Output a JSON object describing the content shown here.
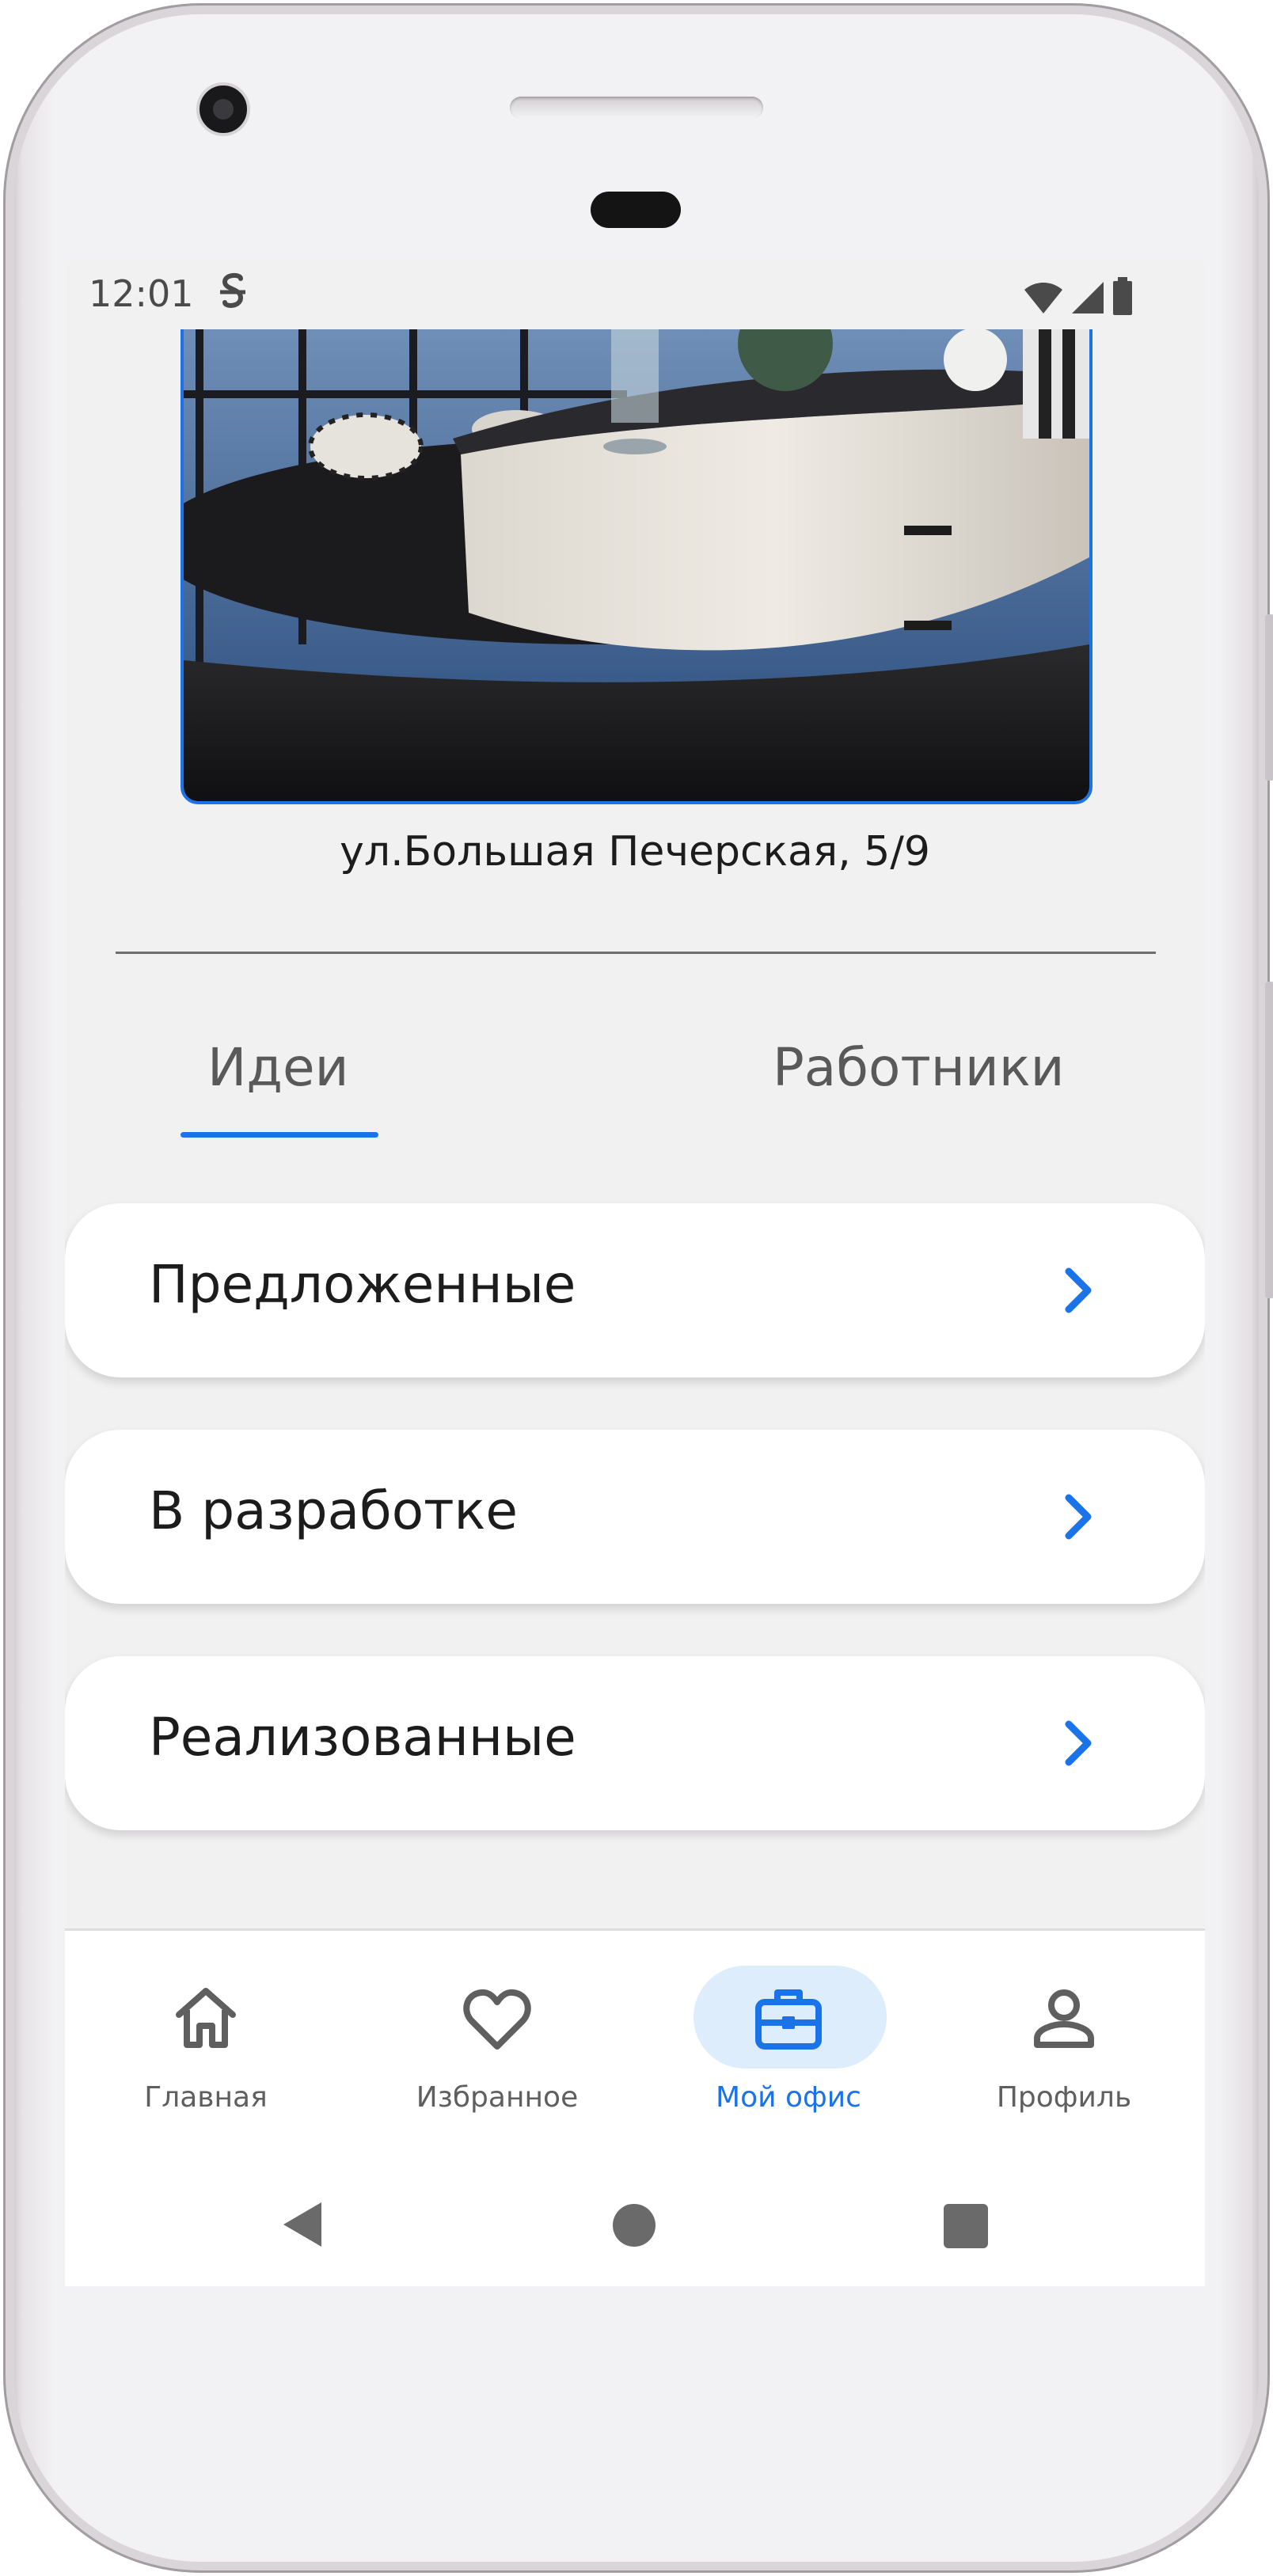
{
  "status_bar": {
    "time": "12:01"
  },
  "office": {
    "address": "ул.Большая Печерская, 5/9"
  },
  "tabs": [
    {
      "label": "Идеи",
      "selected": true
    },
    {
      "label": "Работники",
      "selected": false
    }
  ],
  "idea_categories": [
    {
      "label": "Предложенные",
      "icon": "chevron-right-icon"
    },
    {
      "label": "В разработке",
      "icon": "chevron-right-icon"
    },
    {
      "label": "Реализованные",
      "icon": "chevron-right-icon"
    }
  ],
  "bottom_nav": [
    {
      "label": "Главная",
      "icon": "home-icon",
      "active": false
    },
    {
      "label": "Избранное",
      "icon": "heart-icon",
      "active": false
    },
    {
      "label": "Мой офис",
      "icon": "briefcase-icon",
      "active": true
    },
    {
      "label": "Профиль",
      "icon": "person-icon",
      "active": false
    }
  ],
  "colors": {
    "accent": "#1a73e8",
    "active_pill": "#deedfb",
    "screen_background": "#f2f1f2",
    "card_background": "#ffffff"
  }
}
